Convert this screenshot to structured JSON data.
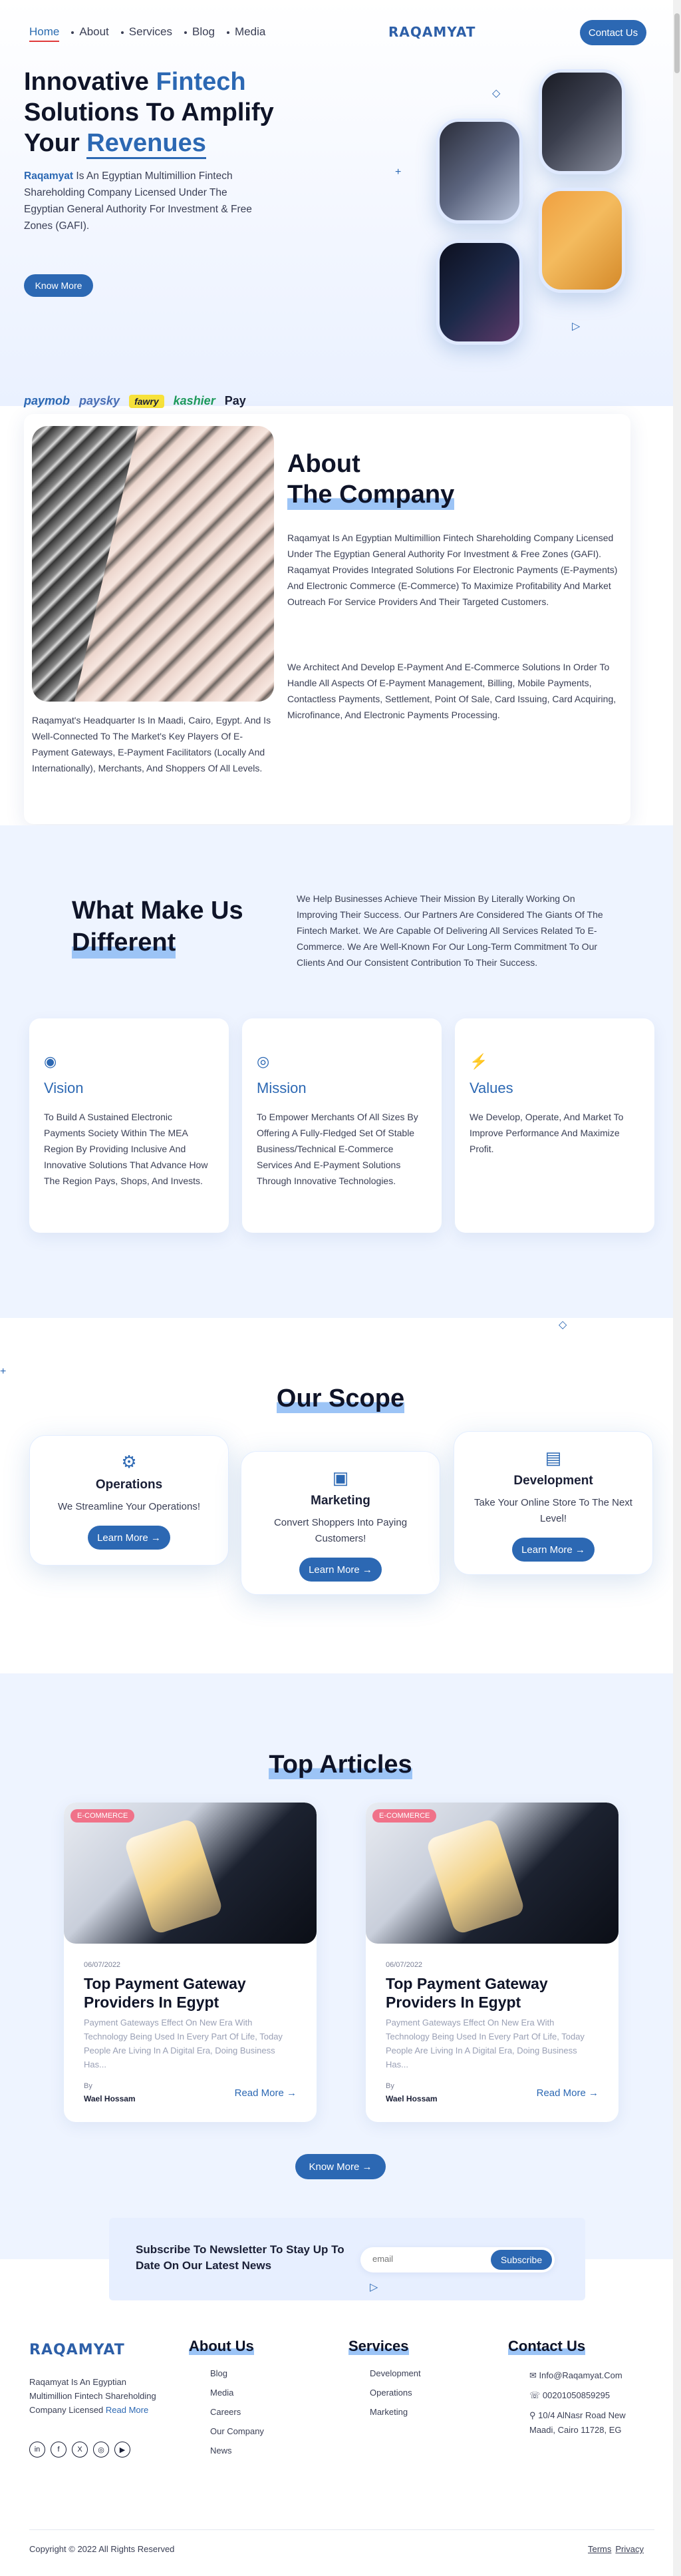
{
  "nav": {
    "links": [
      "Home",
      "About",
      "Services",
      "Blog",
      "Media"
    ],
    "logo": "RAQAMYAT",
    "contact_btn": "Contact Us"
  },
  "hero": {
    "title_a": "Innovative ",
    "title_hl": "Fintech",
    "title_b": " Solutions To Amplify Your ",
    "title_hl2": "Revenues",
    "desc_brand": "Raqamyat",
    "desc": " Is An Egyptian Multimillion Fintech Shareholding Company Licensed Under The Egyptian General Authority For Investment & Free Zones (GAFI).",
    "btn": "Know More"
  },
  "partners": [
    "paymob",
    "paysky",
    "fawry",
    "kashier",
    "Pay"
  ],
  "about": {
    "title_a": "About",
    "title_b": "The Company",
    "p1": "Raqamyat Is An Egyptian Multimillion Fintech Shareholding Company Licensed Under The Egyptian General Authority For Investment & Free Zones (GAFI). Raqamyat Provides Integrated Solutions For Electronic Payments (E-Payments) And Electronic Commerce (E-Commerce) To Maximize Profitability And Market Outreach For Service Providers And Their Targeted Customers.",
    "p2": "We Architect And Develop E-Payment And E-Commerce Solutions In Order To Handle All Aspects Of E-Payment Management, Billing, Mobile Payments, Contactless Payments, Settlement, Point Of Sale, Card Issuing, Card Acquiring, Microfinance, And Electronic Payments Processing.",
    "caption": "Raqamyat's Headquarter Is In Maadi, Cairo, Egypt. And Is Well-Connected To The Market's Key Players Of E-Payment Gateways, E-Payment Facilitators (Locally And Internationally), Merchants, And Shoppers Of All Levels."
  },
  "different": {
    "title_a": "What Make Us",
    "title_b": "Different",
    "text": "We Help Businesses Achieve Their Mission By Literally Working On Improving Their Success. Our Partners Are Considered The Giants Of The Fintech Market. We Are Capable Of Delivering All Services Related To E-Commerce. We Are Well-Known For Our Long-Term Commitment To Our Clients And Our Consistent Contribution To Their Success.",
    "cards": [
      {
        "title": "Vision",
        "desc": "To Build A Sustained Electronic Payments Society Within The MEA Region By Providing Inclusive And Innovative Solutions That Advance How The Region Pays, Shops, And Invests."
      },
      {
        "title": "Mission",
        "desc": "To Empower Merchants Of All Sizes By Offering A Fully-Fledged Set Of Stable Business/Technical E-Commerce Services And E-Payment Solutions Through Innovative Technologies."
      },
      {
        "title": "Values",
        "desc": "We Develop, Operate, And Market To Improve Performance And Maximize Profit."
      }
    ]
  },
  "scope": {
    "title": "Our Scope",
    "cards": [
      {
        "title": "Operations",
        "desc": "We Streamline Your Operations!",
        "btn": "Learn More →"
      },
      {
        "title": "Marketing",
        "desc": "Convert Shoppers Into Paying Customers!",
        "btn": "Learn More →"
      },
      {
        "title": "Development",
        "desc": "Take Your Online Store To The Next Level!",
        "btn": "Learn More →"
      }
    ]
  },
  "articles": {
    "title": "Top Articles",
    "items": [
      {
        "tag": "E-COMMERCE",
        "date": "06/07/2022",
        "title": "Top Payment Gateway Providers In Egypt",
        "desc": "Payment Gateways Effect On New Era With Technology Being Used In Every Part Of Life, Today People Are Living In A Digital Era, Doing Business Has...",
        "by": "By",
        "author": "Wael Hossam",
        "more": "Read More →"
      },
      {
        "tag": "E-COMMERCE",
        "date": "06/07/2022",
        "title": "Top Payment Gateway Providers In Egypt",
        "desc": "Payment Gateways Effect On New Era With Technology Being Used In Every Part Of Life, Today People Are Living In A Digital Era, Doing Business Has...",
        "by": "By",
        "author": "Wael Hossam",
        "more": "Read More →"
      }
    ],
    "btn": "Know More →"
  },
  "newsletter": {
    "title": "Subscribe To Newsletter To Stay Up To Date On Our Latest News",
    "placeholder": "email",
    "btn": "Subscribe"
  },
  "footer": {
    "logo": "RAQAMYAT",
    "about": "Raqamyat Is An Egyptian Multimillion Fintech Shareholding Company Licensed ",
    "read_more": "Read More",
    "socials": [
      "in",
      "f",
      "X",
      "◎",
      "▶"
    ],
    "about_col": {
      "title": "About Us",
      "items": [
        "Blog",
        "Media",
        "Careers",
        "Our Company",
        "News"
      ]
    },
    "services_col": {
      "title": "Services",
      "items": [
        "Development",
        "Operations",
        "Marketing"
      ]
    },
    "contact_col": {
      "title": "Contact Us",
      "email": "Info@Raqamyat.Com",
      "phone": "00201050859295",
      "address": "10/4 AlNasr Road New Maadi, Cairo 11728, EG"
    },
    "copyright": "Copyright © 2022 All Rights Reserved",
    "terms": "Terms",
    "privacy": "Privacy"
  },
  "colors": {
    "brand": "#2c68b3",
    "accent": "#e03a3a",
    "section_bg": "#eef4ff"
  }
}
